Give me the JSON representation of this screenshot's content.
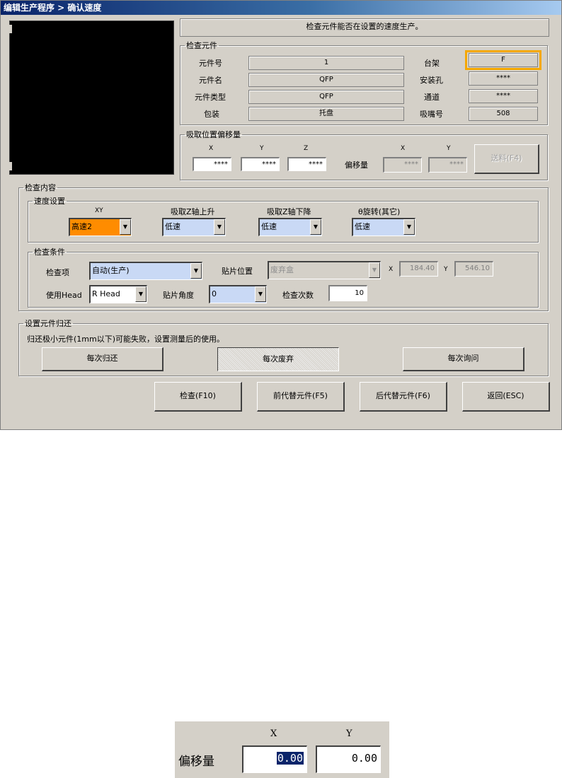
{
  "window": {
    "title": "编辑生产程序 > 确认速度"
  },
  "message": "检查元件能否在设置的速度生产。",
  "part_group": {
    "legend": "检查元件",
    "part_no_label": "元件号",
    "part_no": "1",
    "part_name_label": "元件名",
    "part_name": "QFP",
    "part_type_label": "元件类型",
    "part_type": "QFP",
    "package_label": "包装",
    "package": "托盘",
    "rack_label": "台架",
    "rack": "F",
    "hole_label": "安装孔",
    "hole": "****",
    "channel_label": "通道",
    "channel": "****",
    "nozzle_label": "吸嘴号",
    "nozzle": "508"
  },
  "pick_group": {
    "legend": "吸取位置偏移量",
    "x_label": "X",
    "y_label": "Y",
    "z_label": "Z",
    "x": "****",
    "y": "****",
    "z": "****",
    "offset_label": "偏移量",
    "off_x_label": "X",
    "off_y_label": "Y",
    "off_x": "****",
    "off_y": "****",
    "feed_button": "送料(F4)"
  },
  "inspect_group": {
    "legend": "检查内容",
    "speed": {
      "legend": "速度设置",
      "xy_label": "XY",
      "xy": "高速2",
      "zup_label": "吸取Z轴上升",
      "zup": "低速",
      "zdown_label": "吸取Z轴下降",
      "zdown": "低速",
      "rot_label": "θ旋转(其它)",
      "rot": "低速"
    },
    "cond": {
      "legend": "检查条件",
      "item_label": "检查项",
      "item": "自动(生产)",
      "place_label": "贴片位置",
      "place": "废弃盒",
      "x_label": "X",
      "x": "184.40",
      "y_label": "Y",
      "y": "546.10",
      "head_label": "使用Head",
      "head": "R Head",
      "angle_label": "贴片角度",
      "angle": "0",
      "count_label": "检查次数",
      "count": "10"
    }
  },
  "return_group": {
    "legend": "设置元件归还",
    "note": "归还极小元件(1mm以下)可能失败，设置测量后的使用。",
    "btn_each_return": "每次归还",
    "btn_each_discard": "每次废弃",
    "btn_each_ask": "每次询问"
  },
  "buttons": {
    "check": "检查(F10)",
    "prev_alt": "前代替元件(F5)",
    "next_alt": "后代替元件(F6)",
    "back": "返回(ESC)"
  },
  "zoom": {
    "x_label": "X",
    "y_label": "Y",
    "offset_label": "偏移量",
    "x_value": "0.00",
    "y_value": "0.00"
  },
  "colors": {
    "accent_orange": "#ff8c00",
    "highlight": "#f5a800",
    "combo_blue": "#c9d9f5"
  }
}
